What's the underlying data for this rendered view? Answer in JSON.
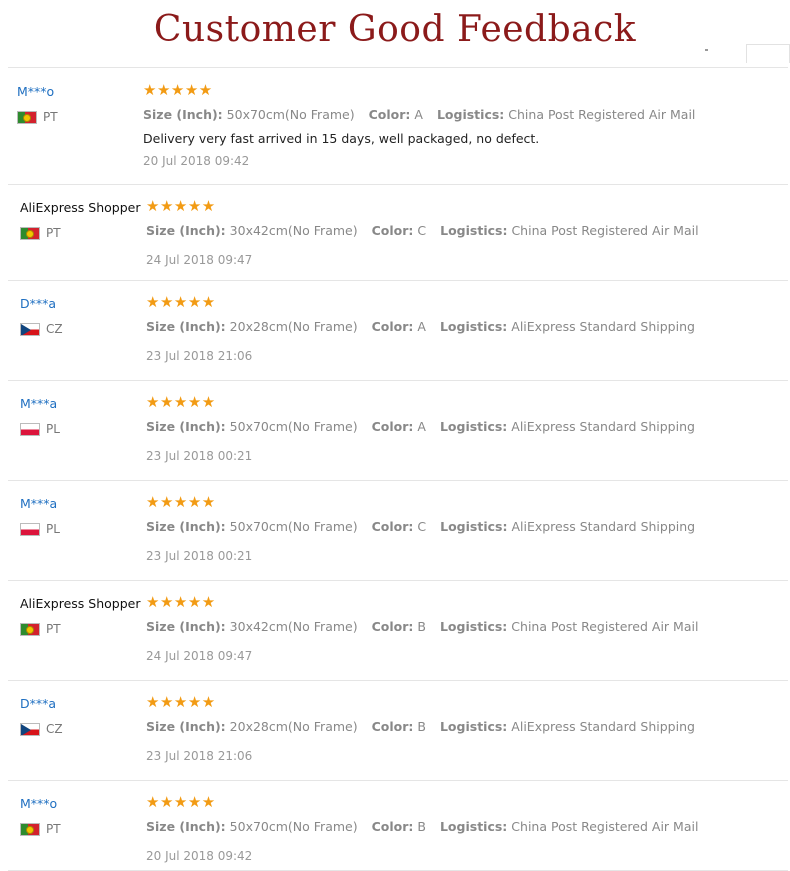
{
  "page_title": "Customer Good Feedback",
  "labels": {
    "size": "Size (Inch):",
    "color": "Color:",
    "logistics": "Logistics:"
  },
  "icons": {
    "rating": "star-icon",
    "country": "flag-icon"
  },
  "colors": {
    "title": "#8b1a1a",
    "stars": "#f29b14",
    "username": "#1f6fc1"
  },
  "reviews": [
    {
      "user": "M***o",
      "country": "PT",
      "flag": "pt",
      "rating": 5,
      "stars": "★★★★★",
      "size": "50x70cm(No Frame)",
      "color": "A",
      "logistics": "China Post Registered Air Mail",
      "comment": "Delivery very fast arrived in 15 days, well packaged, no defect.",
      "date": "20 Jul 2018 09:42"
    },
    {
      "user": "AliExpress Shopper",
      "country": "PT",
      "flag": "pt",
      "rating": 5,
      "stars": "★★★★★",
      "size": "30x42cm(No Frame)",
      "color": "C",
      "logistics": "China Post Registered Air Mail",
      "comment": "",
      "date": "24 Jul 2018 09:47"
    },
    {
      "user": "D***a",
      "country": "CZ",
      "flag": "cz",
      "rating": 5,
      "stars": "★★★★★",
      "size": "20x28cm(No Frame)",
      "color": "A",
      "logistics": "AliExpress Standard Shipping",
      "comment": "",
      "date": "23 Jul 2018 21:06"
    },
    {
      "user": "M***a",
      "country": "PL",
      "flag": "pl",
      "rating": 5,
      "stars": "★★★★★",
      "size": "50x70cm(No Frame)",
      "color": "A",
      "logistics": "AliExpress Standard Shipping",
      "comment": "",
      "date": "23 Jul 2018 00:21"
    },
    {
      "user": "M***a",
      "country": "PL",
      "flag": "pl",
      "rating": 5,
      "stars": "★★★★★",
      "size": "50x70cm(No Frame)",
      "color": "C",
      "logistics": "AliExpress Standard Shipping",
      "comment": "",
      "date": "23 Jul 2018 00:21"
    },
    {
      "user": "AliExpress Shopper",
      "country": "PT",
      "flag": "pt",
      "rating": 5,
      "stars": "★★★★★",
      "size": "30x42cm(No Frame)",
      "color": "B",
      "logistics": "China Post Registered Air Mail",
      "comment": "",
      "date": "24 Jul 2018 09:47"
    },
    {
      "user": "D***a",
      "country": "CZ",
      "flag": "cz",
      "rating": 5,
      "stars": "★★★★★",
      "size": "20x28cm(No Frame)",
      "color": "B",
      "logistics": "AliExpress Standard Shipping",
      "comment": "",
      "date": "23 Jul 2018 21:06"
    },
    {
      "user": "M***o",
      "country": "PT",
      "flag": "pt",
      "rating": 5,
      "stars": "★★★★★",
      "size": "50x70cm(No Frame)",
      "color": "B",
      "logistics": "China Post Registered Air Mail",
      "comment": "",
      "date": "20 Jul 2018 09:42"
    }
  ]
}
